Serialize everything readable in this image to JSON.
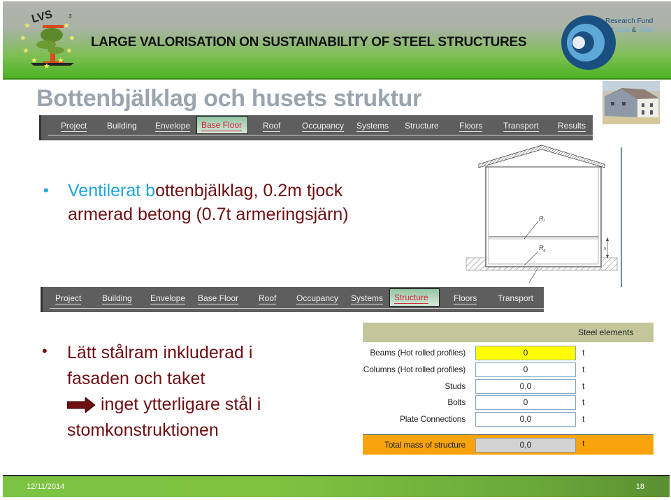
{
  "header": {
    "logo_text": "LVS",
    "logo_superscript": "3",
    "title": "LARGE VALORISATION ON SUSTAINABILITY OF STEEL STRUCTURES",
    "partner_logo": {
      "line1": "Research Fund",
      "line2_prefix": "for ",
      "line2_coal": "Coal",
      "line2_amp": " & ",
      "line2_steel": "Steel"
    }
  },
  "slide": {
    "title": "Bottenbjälklag och husets struktur"
  },
  "tabbar_top": {
    "tabs": [
      {
        "label": "Project",
        "active": false
      },
      {
        "label": "Building",
        "active": false
      },
      {
        "label": "Envelope",
        "active": false
      },
      {
        "label": "Base Floor",
        "active": true
      },
      {
        "label": "Roof",
        "active": false
      },
      {
        "label": "Occupancy",
        "active": false
      },
      {
        "label": "Systems",
        "active": false
      },
      {
        "label": "Structure",
        "active": false
      },
      {
        "label": "Floors",
        "active": false
      },
      {
        "label": "Transport",
        "active": false
      },
      {
        "label": "Results",
        "active": false
      }
    ]
  },
  "tabbar_bottom": {
    "tabs": [
      {
        "label": "Project",
        "active": false
      },
      {
        "label": "Building",
        "active": false
      },
      {
        "label": "Envelope",
        "active": false
      },
      {
        "label": "Base Floor",
        "active": false
      },
      {
        "label": "Roof",
        "active": false
      },
      {
        "label": "Occupancy",
        "active": false
      },
      {
        "label": "Systems",
        "active": false
      },
      {
        "label": "Structure",
        "active": true
      },
      {
        "label": "Floors",
        "active": false
      },
      {
        "label": "Transport",
        "active": false
      }
    ]
  },
  "bullets": {
    "first": {
      "highlight": "Ventilerat b",
      "rest_line1": "ottenbjälklag, 0.2m tjock",
      "line2": "armerad betong (0.7t armeringsjärn)"
    },
    "second": {
      "line1": "Lätt stålram inkluderad i",
      "line2": "fasaden och taket",
      "line3": "inget ytterligare stål i",
      "line4": "stomkonstruktionen"
    }
  },
  "diagram": {
    "label_r1": "R",
    "label_r1_sub": "f",
    "label_r2": "R",
    "label_r2_sub": "g",
    "label_h": "h"
  },
  "steel_panel": {
    "header": "Steel elements",
    "rows": [
      {
        "label": "Beams (Hot rolled profiles)",
        "value": "0",
        "unit": "t",
        "highlighted": true
      },
      {
        "label": "Columns (Hot rolled profiles)",
        "value": "0",
        "unit": "t",
        "highlighted": false
      },
      {
        "label": "Studs",
        "value": "0,0",
        "unit": "t",
        "highlighted": false
      },
      {
        "label": "Bolts",
        "value": "0",
        "unit": "t",
        "highlighted": false
      },
      {
        "label": "Plate Connections",
        "value": "0,0",
        "unit": "t",
        "highlighted": false
      }
    ],
    "total": {
      "label": "Total mass of structure",
      "value": "0,0",
      "unit": "t"
    }
  },
  "footer": {
    "date": "12/11/2014",
    "page": "18"
  },
  "colors": {
    "header_green": "#4cb223",
    "title_gray": "#9aa4ae",
    "text_maroon": "#6e0f12",
    "accent_cyan": "#1ea6dc",
    "active_tab_red": "#d0253a",
    "total_orange": "#f9a40d",
    "highlight_yellow": "#ffff00"
  }
}
